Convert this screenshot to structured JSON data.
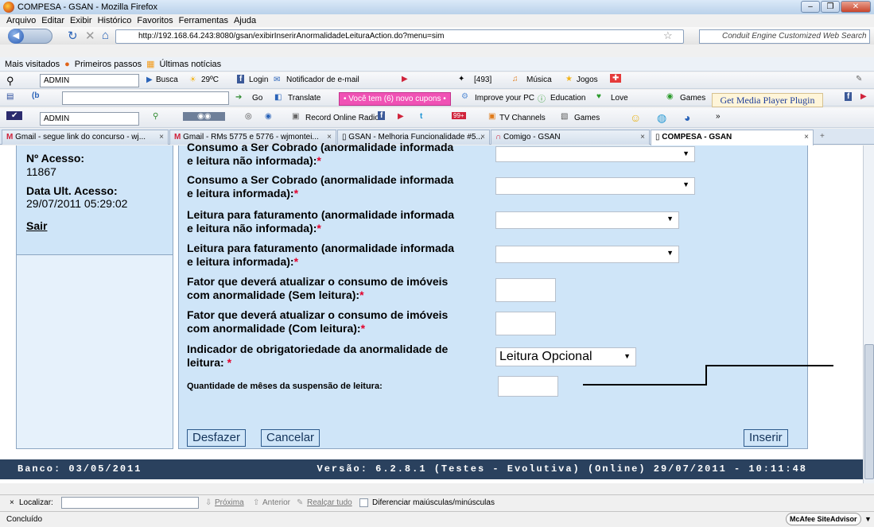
{
  "window": {
    "title": "COMPESA - GSAN - Mozilla Firefox",
    "controls": [
      "–",
      "❐",
      "✕"
    ]
  },
  "menu": [
    "Arquivo",
    "Editar",
    "Exibir",
    "Histórico",
    "Favoritos",
    "Ferramentas",
    "Ajuda"
  ],
  "nav": {
    "url": "http://192.168.64.243:8080/gsan/exibirInserirAnormalidadeLeituraAction.do?menu=sim",
    "search_placeholder": "Conduit Engine Customized Web Search"
  },
  "bookmarks": [
    "Mais visitados",
    "Primeiros passos",
    "Últimas notícias"
  ],
  "toolbar1": {
    "user": "ADMIN",
    "busca": "Busca",
    "weather": "29ºC",
    "login": "Login",
    "notificador": "Notificador de e-mail",
    "count": "[493]",
    "musica": "Música",
    "jogos": "Jogos"
  },
  "toolbar2": {
    "go": "Go",
    "translate": "Translate",
    "promo": "• Você tem (6) novo cupons •",
    "improve": "Improve your PC",
    "education": "Education",
    "love": "Love",
    "games": "Games",
    "media": "Get Media Player Plugin"
  },
  "toolbar3": {
    "user": "ADMIN",
    "radio": "Record Online Radio",
    "tv": "TV Channels",
    "games": "Games",
    "badge": "99+"
  },
  "tabs": [
    {
      "label": "Gmail - segue link do concurso - wj...",
      "active": false
    },
    {
      "label": "Gmail - RMs 5775 e 5776 - wjmontei...",
      "active": false
    },
    {
      "label": "GSAN - Melhoria Funcionalidade #5...",
      "active": false
    },
    {
      "label": "Comigo - GSAN",
      "active": false
    },
    {
      "label": "COMPESA - GSAN",
      "active": true
    }
  ],
  "sidebar": {
    "acesso_label": "Nº Acesso:",
    "acesso_value": "11867",
    "data_label": "Data Ult. Acesso:",
    "data_value": "29/07/2011 05:29:02",
    "sair": "Sair"
  },
  "form": {
    "f1_line1": "Consumo a Ser Cobrado (anormalidade informada",
    "f1_line2": "e leitura não informada):",
    "f2_line1": "Consumo a Ser Cobrado (anormalidade informada",
    "f2_line2": "e leitura informada):",
    "f3_line1": "Leitura para faturamento (anormalidade informada",
    "f3_line2": "e leitura não informada):",
    "f4_line1": "Leitura para faturamento (anormalidade informada",
    "f4_line2": "e leitura informada):",
    "f5_line1": "Fator que deverá atualizar o consumo de imóveis",
    "f5_line2": "com anormalidade (Sem leitura):",
    "f6_line1": "Fator que deverá atualizar o consumo de imóveis",
    "f6_line2": "com anormalidade (Com leitura):",
    "f7_line1": "Indicador de obrigatoriedade da anormalidade de",
    "f7_line2": "leitura:",
    "f7_value": "Leitura Opcional",
    "f8_label": "Quantidade de mêses da suspensão de leitura:",
    "required": "*"
  },
  "buttons": {
    "desfazer": "Desfazer",
    "cancelar": "Cancelar",
    "inserir": "Inserir"
  },
  "footer": {
    "banco": "Banco: 03/05/2011",
    "versao": "Versão: 6.2.8.1 (Testes - Evolutiva) (Online) 29/07/2011 - 10:11:48"
  },
  "findbar": {
    "close": "×",
    "label": "Localizar:",
    "next": "Próxima",
    "prev": "Anterior",
    "highlight": "Realçar tudo",
    "match_case": "Diferenciar maiúsculas/minúsculas"
  },
  "status": {
    "text": "Concluído",
    "mcafee": "McAfee SiteAdvisor"
  }
}
